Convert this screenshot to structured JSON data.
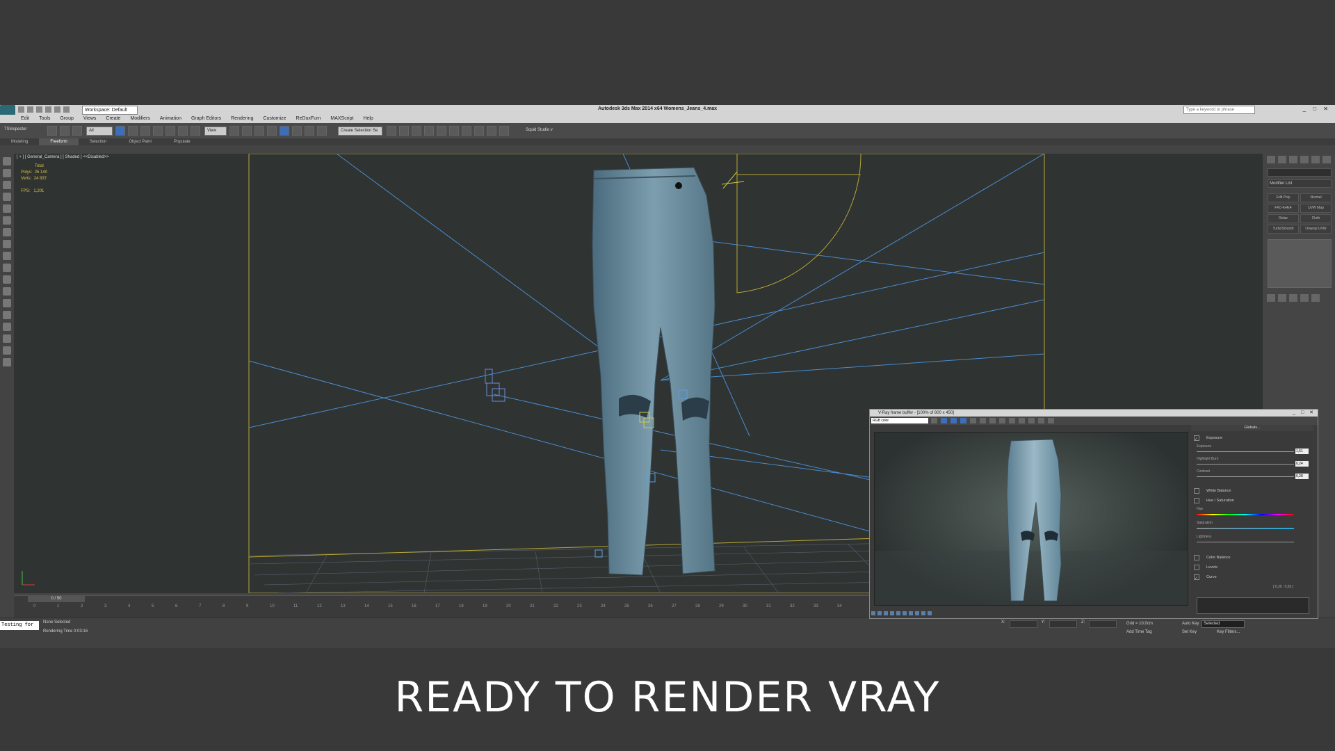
{
  "app": {
    "title": "Autodesk 3ds Max 2014 x64    Womens_Jeans_4.max",
    "workspace": "Workspace: Default",
    "search_placeholder": "Type a keyword or phrase",
    "menu": [
      "Edit",
      "Tools",
      "Group",
      "Views",
      "Create",
      "Modifiers",
      "Animation",
      "Graph Editors",
      "Rendering",
      "Customize",
      "ReDuxFurn",
      "MAXScript",
      "Help"
    ],
    "toolbar": {
      "inspector": "TSInspector",
      "filter": "All",
      "view": "View",
      "selection_set": "Create Selection Se",
      "squid": "Squid Studio v"
    },
    "ribbon_tabs": [
      "Modeling",
      "Freeform",
      "Selection",
      "Object Paint",
      "Populate"
    ],
    "ribbon_active": "Freeform"
  },
  "viewport": {
    "label": "[ + ] [ General_Camera ] [ Shaded ]  <<Disabled>>",
    "stats": {
      "header": "Total",
      "polys_label": "Polys:",
      "polys": "25 140",
      "verts_label": "Verts:",
      "verts": "24 837",
      "fps_label": "FPS:",
      "fps": "1,201"
    }
  },
  "modifier_panel": {
    "dropdown": "Modifier List",
    "buttons": [
      "Edit Poly",
      "Normal",
      "FFD 4x4x4",
      "UVW Map",
      "Relax",
      "Cloth",
      "TurboSmooth",
      "Unwrap UVW"
    ]
  },
  "timeline": {
    "slider": "0 / 50",
    "ticks": [
      "0",
      "1",
      "2",
      "3",
      "4",
      "5",
      "6",
      "7",
      "8",
      "9",
      "10",
      "11",
      "12",
      "13",
      "14",
      "15",
      "16",
      "17",
      "18",
      "19",
      "20",
      "21",
      "22",
      "23",
      "24",
      "25",
      "26",
      "27",
      "28",
      "29",
      "30",
      "31",
      "32",
      "33",
      "34"
    ]
  },
  "status": {
    "maxscript": "Testing for",
    "selection": "None Selected",
    "render_time": "Rendering Time  0:03:16",
    "grid": "Grid = 10,0cm",
    "add_time_tag": "Add Time Tag",
    "auto_key": "Auto Key",
    "set_key": "Set Key",
    "key_mode": "Selected",
    "key_filters": "Key Filters...",
    "coord_x": "X:",
    "coord_y": "Y:",
    "coord_z": "Z:"
  },
  "vfb": {
    "title": "V-Ray frame buffer - [100% of 800 x 450]",
    "channel": "RGB color",
    "panel_title": "Globals...",
    "exposure": {
      "section": "Exposure",
      "exposure_label": "Exposure",
      "exposure_val": "1,51",
      "highlight_label": "Highlight Burn",
      "highlight_val": "0,24",
      "contrast_label": "Contrast",
      "contrast_val": "0,28"
    },
    "sections": {
      "white_balance": "White Balance",
      "hue_sat": "Hue / Saturation",
      "hue": "Hue",
      "saturation": "Saturation",
      "lightness": "Lightness",
      "color_balance": "Color Balance",
      "levels": "Levels",
      "curve": "Curve",
      "curve_val": "[ 0,30 ; 0,82 ]"
    }
  },
  "caption": "READY TO RENDER VRAY",
  "colors": {
    "viewport_bg": "#2f3332",
    "frame": "#c8b43a",
    "wire": "#5aa0e0",
    "denim": "#6f8fa0"
  }
}
